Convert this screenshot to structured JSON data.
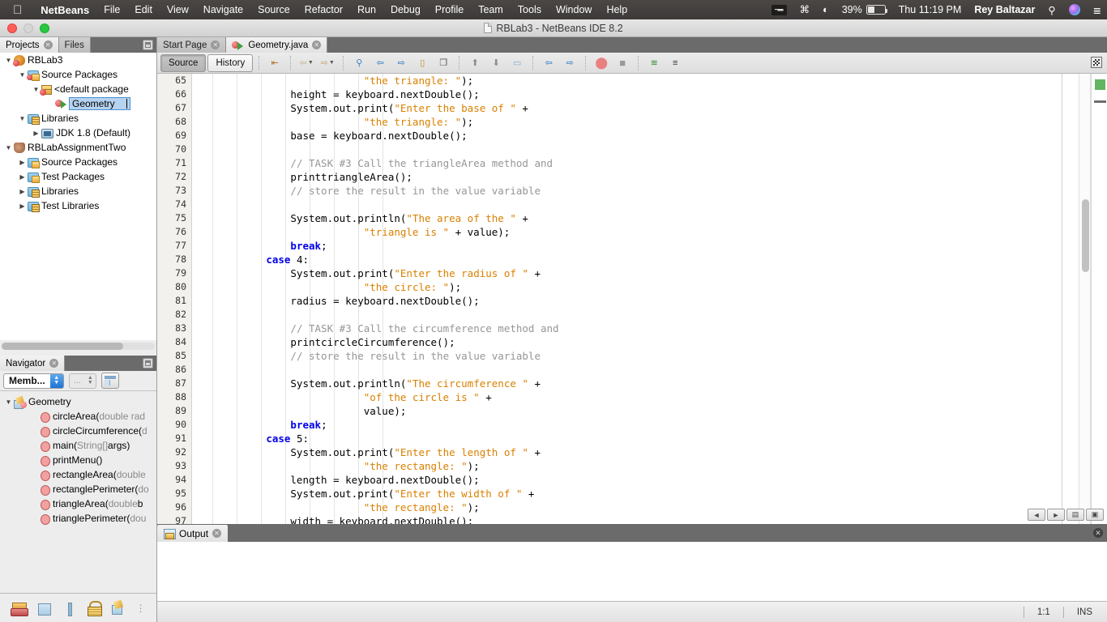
{
  "macbar": {
    "apple_icon": "apple-icon",
    "items": [
      {
        "label": "NetBeans",
        "bold": true
      },
      {
        "label": "File",
        "bold": false
      },
      {
        "label": "Edit",
        "bold": false
      },
      {
        "label": "View",
        "bold": false
      },
      {
        "label": "Navigate",
        "bold": false
      },
      {
        "label": "Source",
        "bold": false
      },
      {
        "label": "Refactor",
        "bold": false
      },
      {
        "label": "Run",
        "bold": false
      },
      {
        "label": "Debug",
        "bold": false
      },
      {
        "label": "Profile",
        "bold": false
      },
      {
        "label": "Team",
        "bold": false
      },
      {
        "label": "Tools",
        "bold": false
      },
      {
        "label": "Window",
        "bold": false
      },
      {
        "label": "Help",
        "bold": false
      }
    ],
    "status": {
      "keyboard_icon": "keyboard-input-icon",
      "bluetooth_icon": "bluetooth-icon",
      "wifi_icon": "wifi-icon",
      "battery_percent": "39%",
      "battery_icon": "battery-icon",
      "clock": "Thu 11:19 PM",
      "user": "Rey Baltazar",
      "search_icon": "spotlight-search-icon",
      "siri_icon": "siri-icon",
      "notifications_icon": "notification-center-icon"
    }
  },
  "window": {
    "title": "RBLab3 - NetBeans IDE 8.2",
    "doc_icon": "document-icon",
    "close_label": "",
    "minimize_label": "",
    "zoom_label": ""
  },
  "left_tabs": [
    {
      "label": "Projects",
      "active": true,
      "closable": true
    },
    {
      "label": "Files",
      "active": false,
      "closable": false
    }
  ],
  "projects_tree": [
    {
      "indent": 0,
      "twisty": "▼",
      "icon": "project-bean-icon",
      "label": "RBLab3",
      "gray": ""
    },
    {
      "indent": 1,
      "twisty": "▼",
      "icon": "source-packages-icon",
      "label": "Source Packages",
      "gray": ""
    },
    {
      "indent": 2,
      "twisty": "▼",
      "icon": "default-package-icon",
      "label": "<default package",
      "gray": ""
    },
    {
      "indent": 3,
      "twisty": "",
      "icon": "java-class-icon",
      "label": "Geometry",
      "gray": "",
      "editing": true
    },
    {
      "indent": 1,
      "twisty": "▼",
      "icon": "libraries-icon",
      "label": "Libraries",
      "gray": ""
    },
    {
      "indent": 2,
      "twisty": "▶",
      "icon": "jdk-icon",
      "label": "JDK 1.8 (Default)",
      "gray": ""
    },
    {
      "indent": 0,
      "twisty": "▼",
      "icon": "java-project-cup-icon",
      "label": "RBLabAssignmentTwo",
      "gray": ""
    },
    {
      "indent": 1,
      "twisty": "▶",
      "icon": "source-packages-icon",
      "label": "Source Packages",
      "gray": ""
    },
    {
      "indent": 1,
      "twisty": "▶",
      "icon": "test-packages-icon",
      "label": "Test Packages",
      "gray": ""
    },
    {
      "indent": 1,
      "twisty": "▶",
      "icon": "libraries-icon",
      "label": "Libraries",
      "gray": ""
    },
    {
      "indent": 1,
      "twisty": "▶",
      "icon": "test-libraries-icon",
      "label": "Test Libraries",
      "gray": ""
    }
  ],
  "navigator": {
    "tab_label": "Navigator",
    "scope_value": "Memb...",
    "filter_value": "...",
    "filter_button_icon": "filter-panel-icon",
    "root": {
      "label": "Geometry",
      "icon": "navigator-class-icon",
      "twisty": "▼"
    },
    "members": [
      {
        "name": "circleArea(",
        "param": "double rad",
        "tail": ""
      },
      {
        "name": "circleCircumference(",
        "param": "d",
        "tail": ""
      },
      {
        "name": "main(",
        "param": "String[]",
        "tail": " args)"
      },
      {
        "name": "printMenu()",
        "param": "",
        "tail": ""
      },
      {
        "name": "rectangleArea(",
        "param": "double",
        "tail": ""
      },
      {
        "name": "rectanglePerimeter(",
        "param": "do",
        "tail": ""
      },
      {
        "name": "triangleArea(",
        "param": "double",
        "tail": " b"
      },
      {
        "name": "trianglePerimeter(",
        "param": "dou",
        "tail": ""
      }
    ]
  },
  "dock_icons": [
    {
      "name": "team-icon"
    },
    {
      "name": "projects-window-icon"
    },
    {
      "name": "files-window-icon"
    },
    {
      "name": "services-lock-icon"
    },
    {
      "name": "navigator-window-icon"
    },
    {
      "name": "more-windows-icon"
    }
  ],
  "editor_tabs": [
    {
      "label": "Start Page",
      "active": false,
      "icon": "",
      "closable": true
    },
    {
      "label": "Geometry.java",
      "active": true,
      "icon": "java-class-icon",
      "closable": true
    }
  ],
  "editor_toolbar": {
    "source_label": "Source",
    "history_label": "History",
    "buttons": [
      {
        "name": "last-edit-position-icon",
        "glyph": "⇤"
      },
      {
        "name": "back-navigation-icon",
        "glyph": "⇦",
        "has_dropdown": true,
        "disabled": true
      },
      {
        "name": "forward-navigation-icon",
        "glyph": "⇨",
        "has_dropdown": true,
        "disabled": true
      },
      {
        "name": "find-selection-icon",
        "glyph": "⌕"
      },
      {
        "name": "find-previous-icon",
        "glyph": "⇦"
      },
      {
        "name": "find-next-icon",
        "glyph": "⇨"
      },
      {
        "name": "toggle-highlight-icon",
        "glyph": "▭"
      },
      {
        "name": "toggle-rectangular-selection-icon",
        "glyph": "⬚"
      },
      {
        "name": "previous-bookmark-icon",
        "glyph": "⬆"
      },
      {
        "name": "next-bookmark-icon",
        "glyph": "⬇"
      },
      {
        "name": "toggle-bookmark-icon",
        "glyph": "▱"
      },
      {
        "name": "shift-line-left-icon",
        "glyph": "⇦"
      },
      {
        "name": "shift-line-right-icon",
        "glyph": "⇨"
      },
      {
        "name": "start-macro-recording-icon",
        "glyph": "⬤"
      },
      {
        "name": "stop-macro-recording-icon",
        "glyph": "⬛"
      },
      {
        "name": "inspect-members-icon",
        "glyph": "≋"
      },
      {
        "name": "format-icon",
        "glyph": "≡"
      }
    ],
    "maximize_icon": "toggle-maximize-icon"
  },
  "code": {
    "first_line": 65,
    "lines": [
      {
        "n": 65,
        "tokens": [
          {
            "t": "                            ",
            "c": ""
          },
          {
            "t": "\"the triangle: \"",
            "c": "s"
          },
          {
            "t": ");",
            "c": ""
          }
        ]
      },
      {
        "n": 66,
        "tokens": [
          {
            "t": "                height = keyboard.nextDouble();",
            "c": ""
          }
        ]
      },
      {
        "n": 67,
        "tokens": [
          {
            "t": "                System.out.print(",
            "c": ""
          },
          {
            "t": "\"Enter the base of \"",
            "c": "s"
          },
          {
            "t": " +",
            "c": ""
          }
        ]
      },
      {
        "n": 68,
        "tokens": [
          {
            "t": "                            ",
            "c": ""
          },
          {
            "t": "\"the triangle: \"",
            "c": "s"
          },
          {
            "t": ");",
            "c": ""
          }
        ]
      },
      {
        "n": 69,
        "tokens": [
          {
            "t": "                base = keyboard.nextDouble();",
            "c": ""
          }
        ]
      },
      {
        "n": 70,
        "tokens": [
          {
            "t": "",
            "c": ""
          }
        ]
      },
      {
        "n": 71,
        "tokens": [
          {
            "t": "                ",
            "c": ""
          },
          {
            "t": "// TASK #3 Call the triangleArea method and",
            "c": "c"
          }
        ]
      },
      {
        "n": 72,
        "tokens": [
          {
            "t": "                printtriangleArea();",
            "c": ""
          }
        ]
      },
      {
        "n": 73,
        "tokens": [
          {
            "t": "                ",
            "c": ""
          },
          {
            "t": "// store the result in the value variable",
            "c": "c"
          }
        ]
      },
      {
        "n": 74,
        "tokens": [
          {
            "t": "",
            "c": ""
          }
        ]
      },
      {
        "n": 75,
        "tokens": [
          {
            "t": "                System.out.println(",
            "c": ""
          },
          {
            "t": "\"The area of the \"",
            "c": "s"
          },
          {
            "t": " +",
            "c": ""
          }
        ]
      },
      {
        "n": 76,
        "tokens": [
          {
            "t": "                            ",
            "c": ""
          },
          {
            "t": "\"triangle is \"",
            "c": "s"
          },
          {
            "t": " + value);",
            "c": ""
          }
        ]
      },
      {
        "n": 77,
        "tokens": [
          {
            "t": "                ",
            "c": ""
          },
          {
            "t": "break",
            "c": "k"
          },
          {
            "t": ";",
            "c": ""
          }
        ]
      },
      {
        "n": 78,
        "tokens": [
          {
            "t": "            ",
            "c": ""
          },
          {
            "t": "case",
            "c": "k"
          },
          {
            "t": " 4:",
            "c": ""
          }
        ]
      },
      {
        "n": 79,
        "tokens": [
          {
            "t": "                System.out.print(",
            "c": ""
          },
          {
            "t": "\"Enter the radius of \"",
            "c": "s"
          },
          {
            "t": " +",
            "c": ""
          }
        ]
      },
      {
        "n": 80,
        "tokens": [
          {
            "t": "                            ",
            "c": ""
          },
          {
            "t": "\"the circle: \"",
            "c": "s"
          },
          {
            "t": ");",
            "c": ""
          }
        ]
      },
      {
        "n": 81,
        "tokens": [
          {
            "t": "                radius = keyboard.nextDouble();",
            "c": ""
          }
        ]
      },
      {
        "n": 82,
        "tokens": [
          {
            "t": "",
            "c": ""
          }
        ]
      },
      {
        "n": 83,
        "tokens": [
          {
            "t": "                ",
            "c": ""
          },
          {
            "t": "// TASK #3 Call the circumference method and",
            "c": "c"
          }
        ]
      },
      {
        "n": 84,
        "tokens": [
          {
            "t": "                printcircleCircumference();",
            "c": ""
          }
        ]
      },
      {
        "n": 85,
        "tokens": [
          {
            "t": "                ",
            "c": ""
          },
          {
            "t": "// store the result in the value variable",
            "c": "c"
          }
        ]
      },
      {
        "n": 86,
        "tokens": [
          {
            "t": "",
            "c": ""
          }
        ]
      },
      {
        "n": 87,
        "tokens": [
          {
            "t": "                System.out.println(",
            "c": ""
          },
          {
            "t": "\"The circumference \"",
            "c": "s"
          },
          {
            "t": " +",
            "c": ""
          }
        ]
      },
      {
        "n": 88,
        "tokens": [
          {
            "t": "                            ",
            "c": ""
          },
          {
            "t": "\"of the circle is \"",
            "c": "s"
          },
          {
            "t": " +",
            "c": ""
          }
        ]
      },
      {
        "n": 89,
        "tokens": [
          {
            "t": "                            value);",
            "c": ""
          }
        ]
      },
      {
        "n": 90,
        "tokens": [
          {
            "t": "                ",
            "c": ""
          },
          {
            "t": "break",
            "c": "k"
          },
          {
            "t": ";",
            "c": ""
          }
        ]
      },
      {
        "n": 91,
        "tokens": [
          {
            "t": "            ",
            "c": ""
          },
          {
            "t": "case",
            "c": "k"
          },
          {
            "t": " 5:",
            "c": ""
          }
        ]
      },
      {
        "n": 92,
        "tokens": [
          {
            "t": "                System.out.print(",
            "c": ""
          },
          {
            "t": "\"Enter the length of \"",
            "c": "s"
          },
          {
            "t": " +",
            "c": ""
          }
        ]
      },
      {
        "n": 93,
        "tokens": [
          {
            "t": "                            ",
            "c": ""
          },
          {
            "t": "\"the rectangle: \"",
            "c": "s"
          },
          {
            "t": ");",
            "c": ""
          }
        ]
      },
      {
        "n": 94,
        "tokens": [
          {
            "t": "                length = keyboard.nextDouble();",
            "c": ""
          }
        ]
      },
      {
        "n": 95,
        "tokens": [
          {
            "t": "                System.out.print(",
            "c": ""
          },
          {
            "t": "\"Enter the width of \"",
            "c": "s"
          },
          {
            "t": " +",
            "c": ""
          }
        ]
      },
      {
        "n": 96,
        "tokens": [
          {
            "t": "                            ",
            "c": ""
          },
          {
            "t": "\"the rectangle: \"",
            "c": "s"
          },
          {
            "t": ");",
            "c": ""
          }
        ]
      },
      {
        "n": 97,
        "tokens": [
          {
            "t": "                width = keyboard.nextDouble();",
            "c": ""
          }
        ]
      }
    ]
  },
  "output": {
    "tab_label": "Output",
    "close_icon": "close-icon",
    "nav_buttons": [
      {
        "name": "output-prev-icon",
        "glyph": "◀"
      },
      {
        "name": "output-next-icon",
        "glyph": "▶"
      },
      {
        "name": "output-list-icon",
        "glyph": "▤"
      },
      {
        "name": "output-maximize-icon",
        "glyph": "▣"
      }
    ],
    "panel_close_icon": "close-icon"
  },
  "statusbar": {
    "cursor_position": "1:1",
    "insert_mode": "INS"
  },
  "colors": {
    "string": "#d98000",
    "keyword": "#0000e6",
    "comment": "#969696",
    "accent": "#1c74d6",
    "error_stripe_ok": "#62b562"
  }
}
